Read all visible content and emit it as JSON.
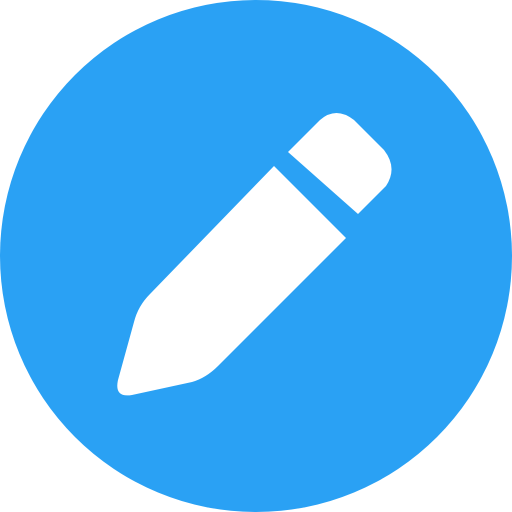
{
  "icon": {
    "name": "edit-pencil-icon",
    "background_color": "#2AA1F4",
    "glyph_color": "#FFFFFF"
  }
}
